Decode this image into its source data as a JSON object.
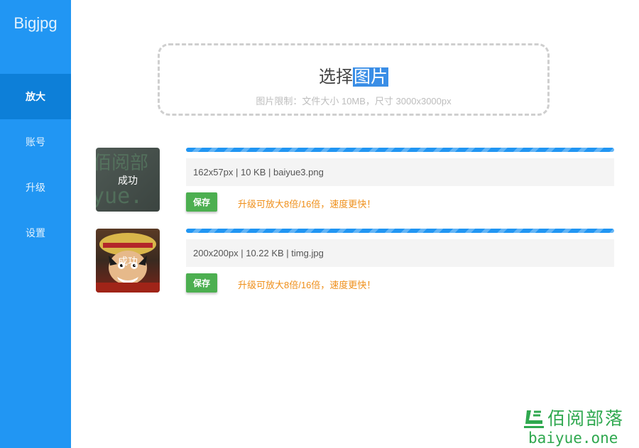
{
  "app": {
    "brand": "Bigjpg"
  },
  "sidebar": {
    "items": [
      {
        "label": "放大",
        "active": true
      },
      {
        "label": "账号",
        "active": false
      },
      {
        "label": "升级",
        "active": false
      },
      {
        "label": "设置",
        "active": false
      }
    ]
  },
  "upload": {
    "title_prefix": "选择",
    "title_highlight": "图片",
    "limit_hint": "图片限制：文件大小 10MB，尺寸 3000x3000px"
  },
  "files": [
    {
      "status": "成功",
      "progress_percent": 100,
      "info": "162x57px | 10 KB | baiyue3.png",
      "save_label": "保存",
      "upgrade_text": "升级可放大8倍/16倍，速度更快！"
    },
    {
      "status": "成功",
      "progress_percent": 100,
      "info": "200x200px | 10.22 KB | timg.jpg",
      "save_label": "保存",
      "upgrade_text": "升级可放大8倍/16倍，速度更快！"
    }
  ],
  "watermark": {
    "chinese": "佰阅部落",
    "latin": "baiyue.one"
  },
  "colors": {
    "sidebar": "#2196f3",
    "sidebar_active": "#0d7fd8",
    "save_button": "#4caf50",
    "upgrade_text": "#ef8f1a",
    "watermark": "#2fa84f"
  }
}
